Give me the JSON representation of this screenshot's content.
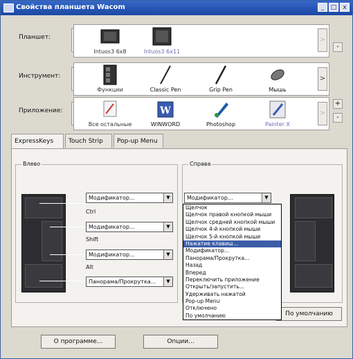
{
  "window": {
    "title": "Свойства планшета Wacom",
    "minimize": "_",
    "restore": "□",
    "close": "x"
  },
  "rows": {
    "tablet": {
      "label": "Планшет:",
      "items": [
        "Intuos3 6x8",
        "Intuos3 6x11"
      ]
    },
    "tool": {
      "label": "Инструмент:",
      "items": [
        "Функции",
        "Classic Pen",
        "Grip Pen",
        "Мышь"
      ]
    },
    "app": {
      "label": "Приложение:",
      "items": [
        "Все остальные",
        "WINWORD",
        "Photoshop",
        "Painter X"
      ]
    }
  },
  "nav": {
    "prev": "<",
    "next": ">",
    "add": "+",
    "remove": "-"
  },
  "tabs": [
    "ExpressKeys",
    "Touch Strip",
    "Pop-up Menu"
  ],
  "left_group": {
    "title": "Влево",
    "controls": [
      {
        "value": "Модификатор...",
        "caption": "Ctrl"
      },
      {
        "value": "Модификатор...",
        "caption": "Shift"
      },
      {
        "value": "Модификатор...",
        "caption": "Alt"
      },
      {
        "value": "Панорама/Прокрутка..."
      }
    ]
  },
  "right_group": {
    "title": "Справа",
    "value": "Модификатор...",
    "options": [
      "Щелчок",
      "Щелчок правой кнопкой мыши",
      "Щелчок средней кнопкой мыши",
      "Щелчок 4-й кнопкой мыши",
      "Щелчок 5-й кнопкой мыши",
      "Нажатие клавиш...",
      "Модификатор...",
      "Панорама/Прокрутка...",
      "Назад",
      "Вперед",
      "Переключить приложение",
      "Открыть/запустить...",
      "Удерживать нажатой",
      "Pop-up Menu",
      "Отключено",
      "По умолчанию"
    ],
    "highlighted_index": 5
  },
  "buttons": {
    "default": "По умолчанию",
    "about": "О программе...",
    "options": "Опции..."
  },
  "colors": {
    "title_bar": "#1c47a3",
    "highlight": "#3c5ea8"
  }
}
